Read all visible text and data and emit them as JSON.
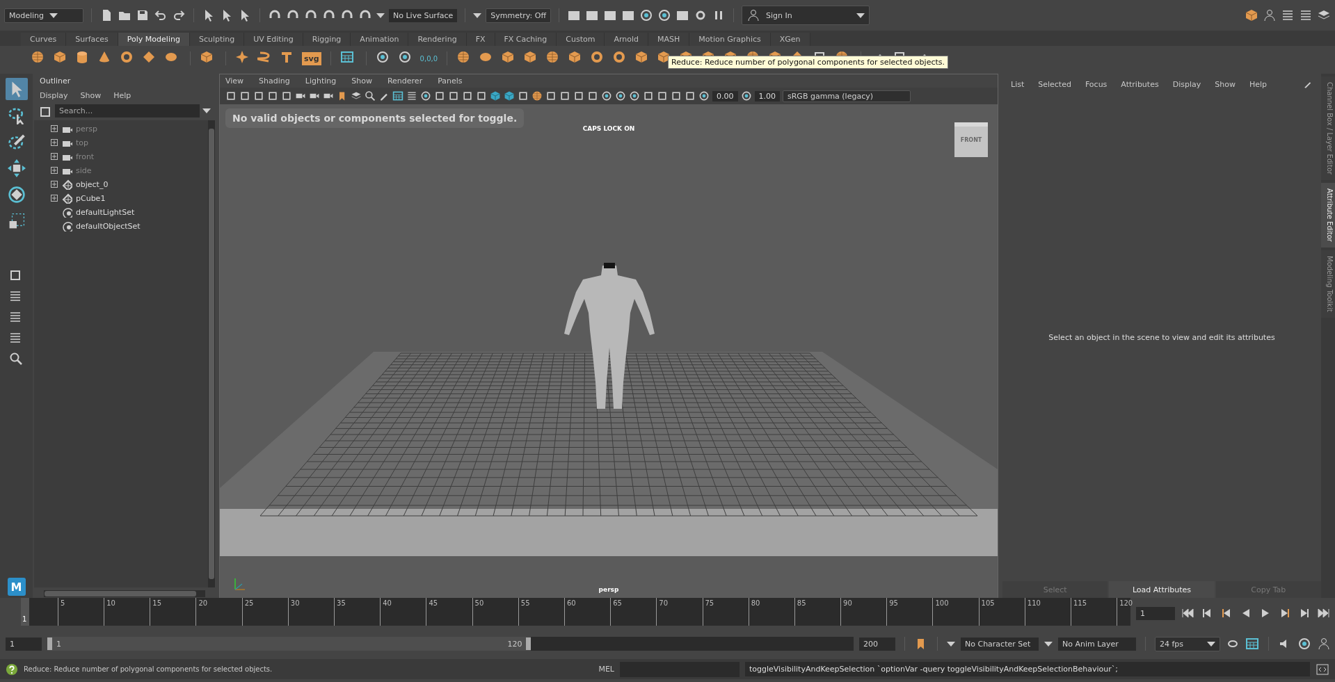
{
  "top_bar": {
    "menu_set": "Modeling",
    "live_surface": "No Live Surface",
    "symmetry": "Symmetry: Off",
    "sign_in": "Sign In"
  },
  "shelf": {
    "tabs": [
      {
        "label": "Curves",
        "selected": false
      },
      {
        "label": "Surfaces",
        "selected": false
      },
      {
        "label": "Poly Modeling",
        "selected": true
      },
      {
        "label": "Sculpting",
        "selected": false
      },
      {
        "label": "UV Editing",
        "selected": false
      },
      {
        "label": "Rigging",
        "selected": false
      },
      {
        "label": "Animation",
        "selected": false
      },
      {
        "label": "Rendering",
        "selected": false
      },
      {
        "label": "FX",
        "selected": false
      },
      {
        "label": "FX Caching",
        "selected": false
      },
      {
        "label": "Custom",
        "selected": false
      },
      {
        "label": "Arnold",
        "selected": false
      },
      {
        "label": "MASH",
        "selected": false
      },
      {
        "label": "Motion Graphics",
        "selected": false
      },
      {
        "label": "XGen",
        "selected": false
      }
    ],
    "svg_label": "svg",
    "origin_label": "0,0,0",
    "tooltip": "Reduce: Reduce number of polygonal components for selected objects."
  },
  "toolbox": [
    {
      "kind": "select",
      "selected": true
    },
    {
      "kind": "lasso",
      "selected": false
    },
    {
      "kind": "paint",
      "selected": false
    },
    {
      "kind": "move",
      "selected": false
    },
    {
      "kind": "rotate",
      "selected": false
    },
    {
      "kind": "scale",
      "selected": false
    }
  ],
  "logo": "M",
  "outliner": {
    "title": "Outliner",
    "menus": [
      "Display",
      "Show",
      "Help"
    ],
    "search_placeholder": "Search...",
    "items": [
      {
        "label": "persp",
        "kind": "camera",
        "hidden": true,
        "expandable": true
      },
      {
        "label": "top",
        "kind": "camera",
        "hidden": true,
        "expandable": true
      },
      {
        "label": "front",
        "kind": "camera",
        "hidden": true,
        "expandable": true
      },
      {
        "label": "side",
        "kind": "camera",
        "hidden": true,
        "expandable": true
      },
      {
        "label": "object_0",
        "kind": "mesh",
        "hidden": false,
        "expandable": true
      },
      {
        "label": "pCube1",
        "kind": "mesh",
        "hidden": false,
        "expandable": true
      },
      {
        "label": "defaultLightSet",
        "kind": "set",
        "hidden": false,
        "expandable": false
      },
      {
        "label": "defaultObjectSet",
        "kind": "set",
        "hidden": false,
        "expandable": false
      }
    ]
  },
  "viewport": {
    "menus": [
      "View",
      "Shading",
      "Lighting",
      "Show",
      "Renderer",
      "Panels"
    ],
    "exposure": "0.00",
    "gamma": "1.00",
    "color_space": "sRGB gamma (legacy)",
    "message": "No valid objects or components selected for toggle.",
    "caps_lock": "CAPS LOCK ON",
    "view_cube": "FRONT",
    "camera": "persp"
  },
  "attribute_editor": {
    "menus": [
      "List",
      "Selected",
      "Focus",
      "Attributes",
      "Display",
      "Show",
      "Help"
    ],
    "message": "Select an object in the scene to view and edit its attributes",
    "buttons": [
      {
        "label": "Select",
        "disabled": true
      },
      {
        "label": "Load Attributes",
        "disabled": false
      },
      {
        "label": "Copy Tab",
        "disabled": true
      }
    ]
  },
  "side_tabs": [
    {
      "label": "Channel Box / Layer Editor",
      "selected": false
    },
    {
      "label": "Attribute Editor",
      "selected": true
    },
    {
      "label": "Modeling Toolkit",
      "selected": false
    }
  ],
  "timeline": {
    "level": 0,
    "current_frame": "1",
    "ticks": [
      "5",
      "10",
      "15",
      "20",
      "25",
      "30",
      "35",
      "40",
      "45",
      "50",
      "55",
      "60",
      "65",
      "70",
      "75",
      "80",
      "85",
      "90",
      "95",
      "100",
      "105",
      "110",
      "115",
      "120"
    ],
    "frame_field": "1"
  },
  "range": {
    "level": 0.6,
    "start": "1",
    "inner_start": "1",
    "inner_end": "120",
    "end": "200",
    "character_set": "No Character Set",
    "anim_layer": "No Anim Layer",
    "fps": "24 fps"
  },
  "status": {
    "help": "Reduce: Reduce number of polygonal components for selected objects.",
    "mel_label": "MEL",
    "command": "toggleVisibilityAndKeepSelection `optionVar -query toggleVisibilityAndKeepSelectionBehaviour`;"
  }
}
